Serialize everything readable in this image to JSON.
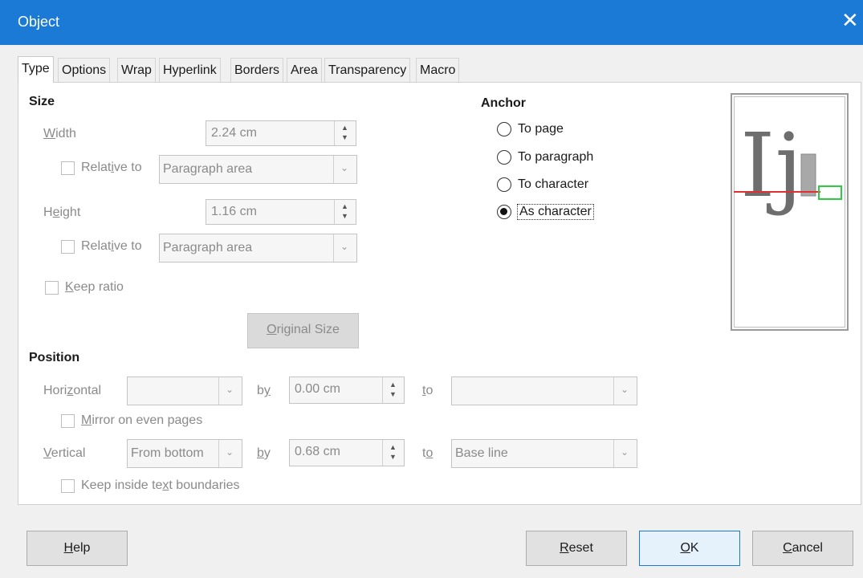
{
  "dialog": {
    "title": "Object",
    "close_glyph": "✕"
  },
  "tabs": [
    "Type",
    "Options",
    "Wrap",
    "Hyperlink",
    "Borders",
    "Area",
    "Transparency",
    "Macro"
  ],
  "size": {
    "heading": "Size",
    "width_label": "Width",
    "width_value": "2.24 cm",
    "relative_to_label": "Relative to",
    "width_relative_value": "Paragraph area",
    "height_label": "Height",
    "height_value": "1.16 cm",
    "height_relative_value": "Paragraph area",
    "keep_ratio_label": "Keep ratio",
    "original_size_label": "Original Size"
  },
  "anchor": {
    "heading": "Anchor",
    "options": [
      "To page",
      "To paragraph",
      "To character",
      "As character"
    ],
    "selected": "As character"
  },
  "preview": {
    "glyphs": "Ij"
  },
  "position": {
    "heading": "Position",
    "horizontal_label": "Horizontal",
    "horizontal_value": "",
    "by_label": "by",
    "horizontal_by_value": "0.00 cm",
    "to_label": "to",
    "horizontal_to_value": "",
    "mirror_label": "Mirror on even pages",
    "vertical_label": "Vertical",
    "vertical_value": "From bottom",
    "vertical_by_value": "0.68 cm",
    "vertical_to_value": "Base line",
    "keep_inside_label": "Keep inside text boundaries"
  },
  "buttons": {
    "help": "Help",
    "reset": "Reset",
    "ok": "OK",
    "cancel": "Cancel"
  },
  "colors": {
    "titlebar": "#1a7ad6",
    "accent_line": "#e03030",
    "frame_box": "#2ecc40"
  }
}
